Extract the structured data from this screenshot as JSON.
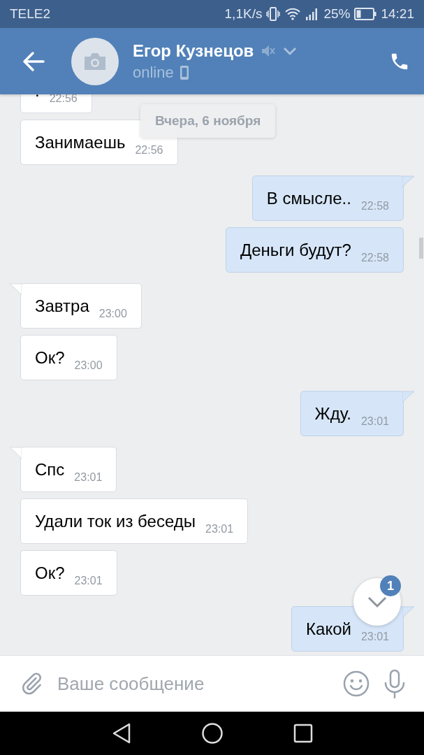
{
  "status_bar": {
    "carrier": "TELE2",
    "speed": "1,1K/s",
    "battery": "25%",
    "time": "14:21"
  },
  "header": {
    "name": "Егор Кузнецов",
    "muted": true,
    "status": "online"
  },
  "date_pill": "Вчера, 6 ноября",
  "messages": [
    {
      "kind": "incoming",
      "text": ".",
      "time": "22:56"
    },
    {
      "kind": "incoming",
      "text": "Занимаешь",
      "time": "22:56"
    },
    {
      "kind": "outgoing",
      "text": "В смысле..",
      "time": "22:58"
    },
    {
      "kind": "outgoing",
      "text": "Деньги будут?",
      "time": "22:58"
    },
    {
      "kind": "incoming",
      "text": "Завтра",
      "time": "23:00"
    },
    {
      "kind": "incoming",
      "text": "Ок?",
      "time": "23:00"
    },
    {
      "kind": "outgoing",
      "text": "Жду.",
      "time": "23:01"
    },
    {
      "kind": "incoming",
      "text": "Спс",
      "time": "23:01"
    },
    {
      "kind": "incoming",
      "text": "Удали ток из беседы",
      "time": "23:01"
    },
    {
      "kind": "incoming",
      "text": "Ок?",
      "time": "23:01"
    },
    {
      "kind": "outgoing",
      "text": "Какой",
      "time": "23:01"
    }
  ],
  "scroll_button": {
    "badge": "1"
  },
  "composer": {
    "placeholder": "Ваше сообщение"
  }
}
